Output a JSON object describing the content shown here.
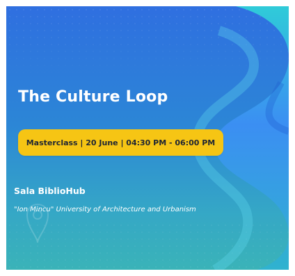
{
  "event": {
    "title": "The Culture Loop",
    "details": "Masterclass | 20 June | 04:30 PM - 06:00 PM",
    "venue": "Sala BiblioHub",
    "institution": "\"Ion Mincu\" University of Architecture and Urbanism"
  },
  "colors": {
    "background_top": "#2f6fe0",
    "background_bottom": "#3ab3b8",
    "pill": "#f6c514",
    "loop_shape": "#3aa0f0",
    "text_light": "#ffffff",
    "text_dark": "#1f2533"
  },
  "icons": {
    "decorative_shape": "loop-icon",
    "watermark": "location-pin-icon"
  }
}
